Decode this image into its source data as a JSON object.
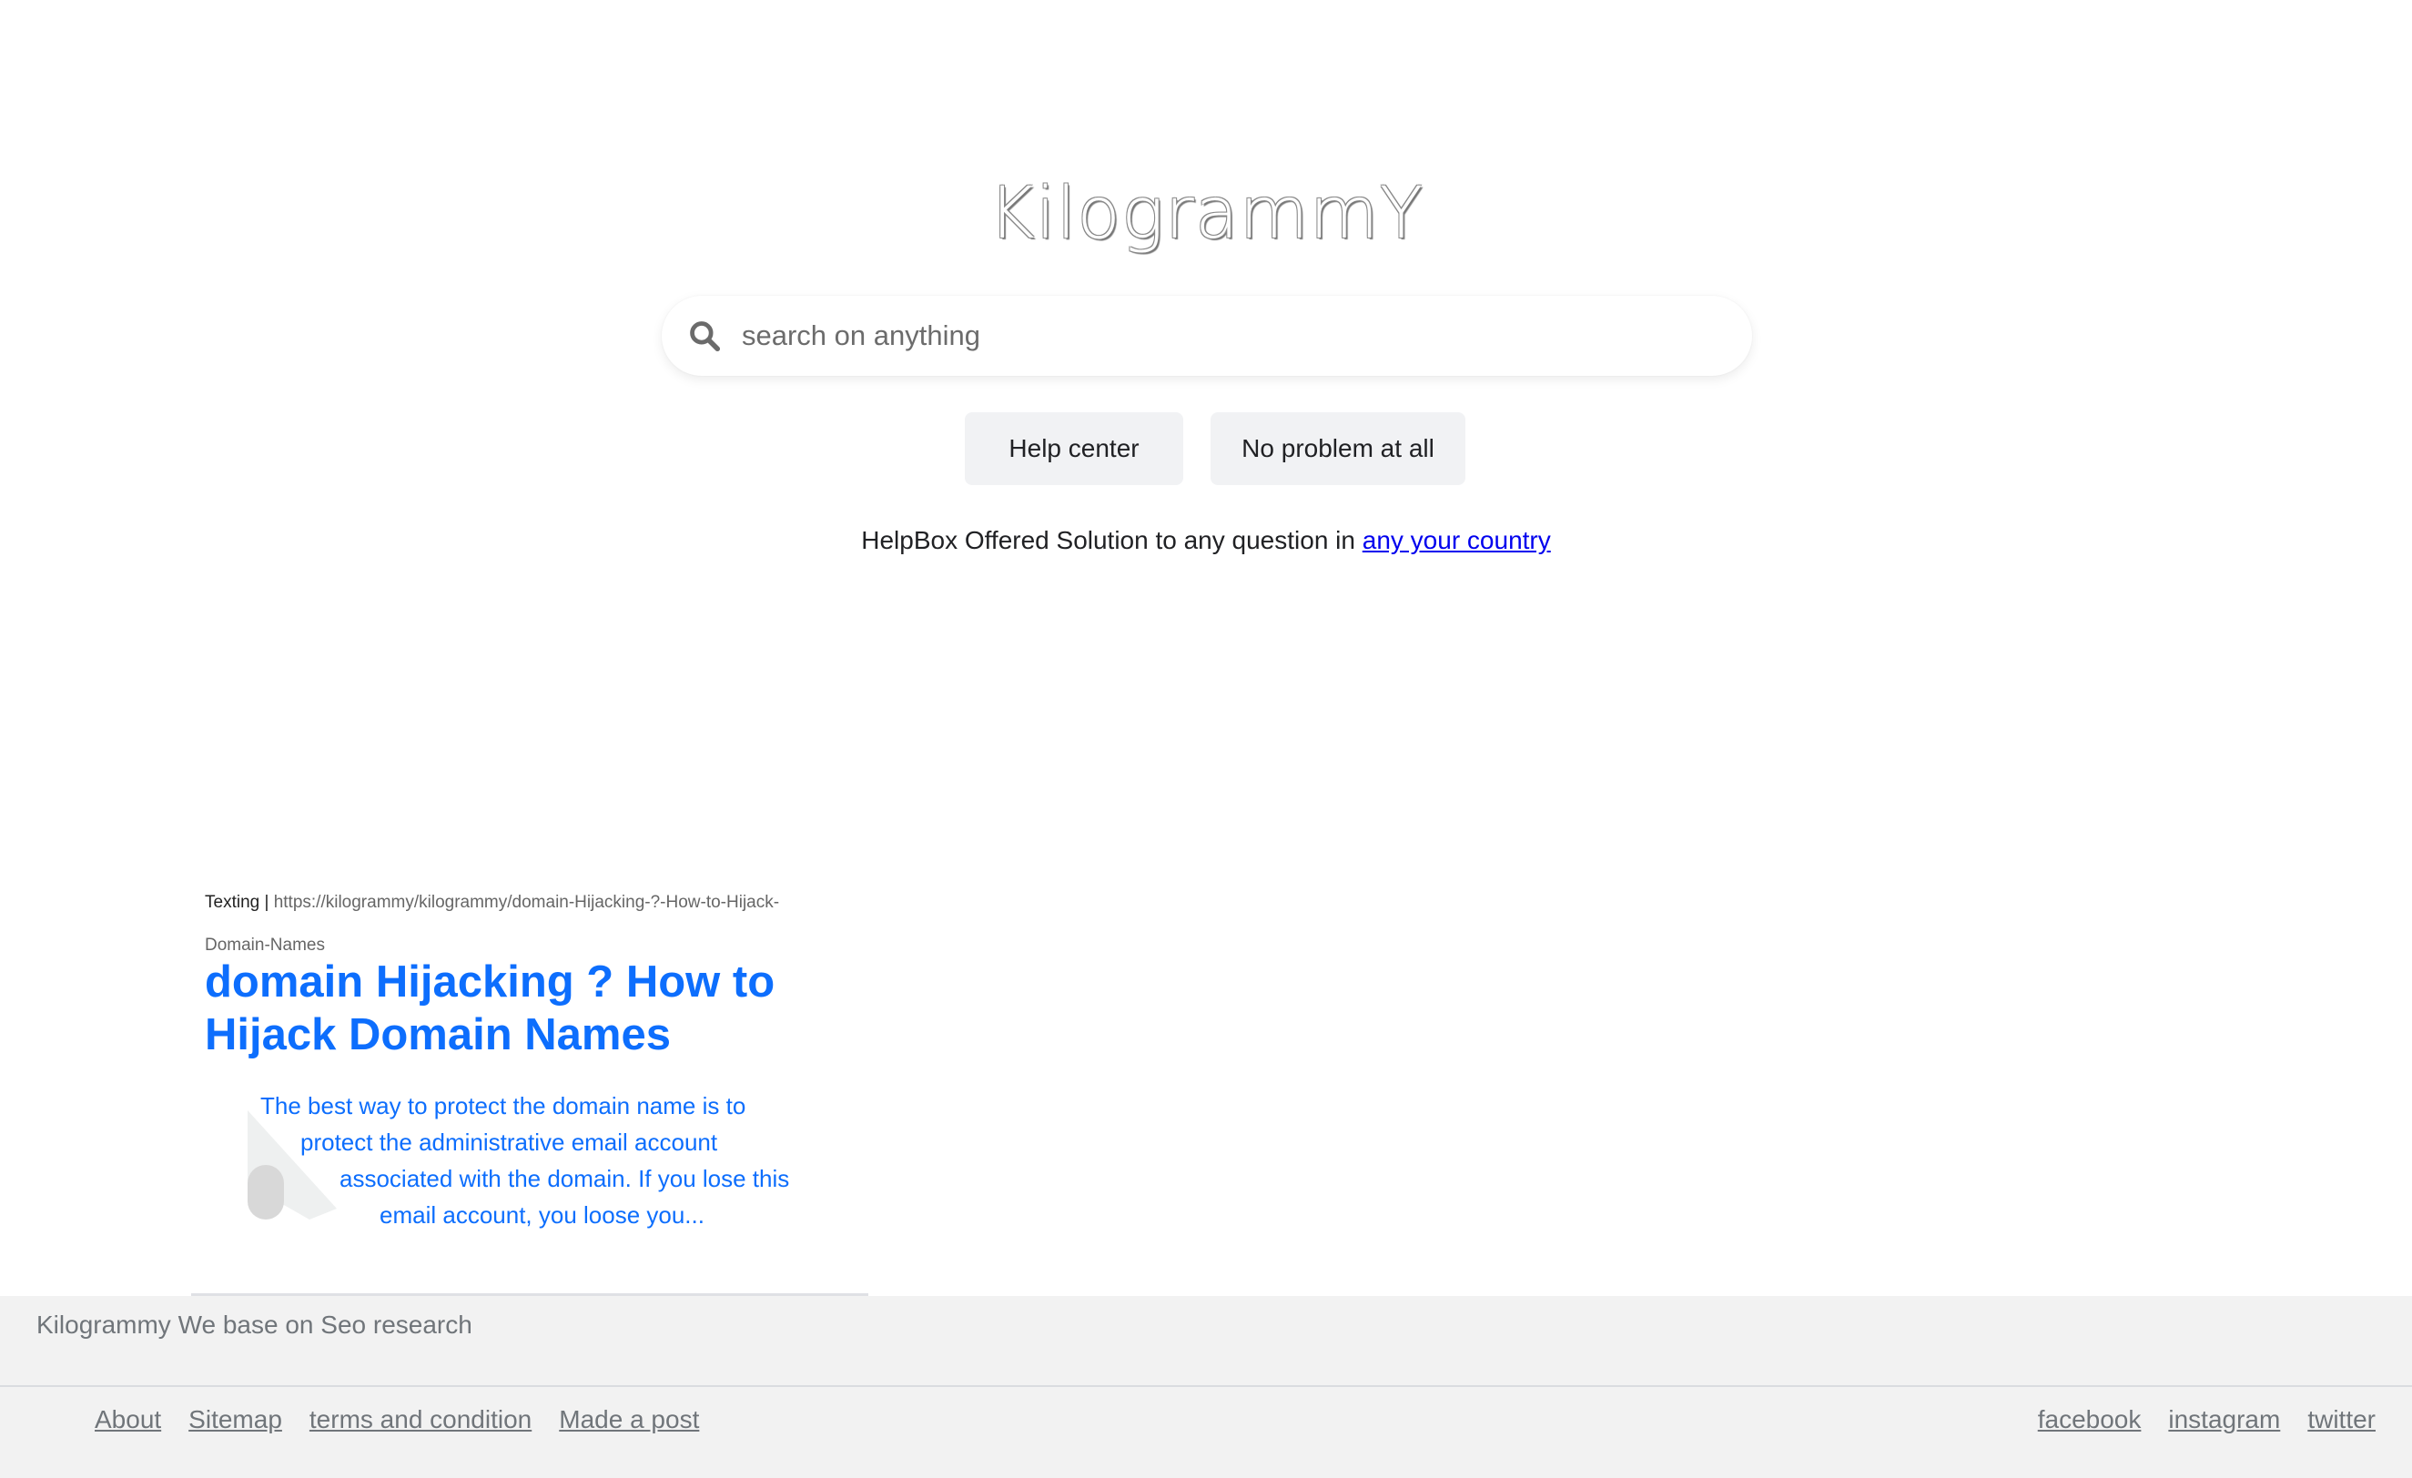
{
  "logo": "KilogrammY",
  "search": {
    "placeholder": "search on anything",
    "value": ""
  },
  "buttons": {
    "help_center": "Help center",
    "no_problem": "No problem at all"
  },
  "tagline": {
    "text": "HelpBox Offered Solution to any question in ",
    "link": "any your country"
  },
  "result": {
    "category": "Texting",
    "separator": "|",
    "url": "https://kilogrammy/kilogrammy/domain-Hijacking-?-How-to-Hijack-Domain-Names",
    "title": "domain Hijacking ? How to Hijack Domain Names",
    "snippet_lines": [
      "The best way to protect the domain name is to",
      "protect the administrative email account",
      "associated with the domain. If you lose this",
      "email account, you loose you..."
    ]
  },
  "footer": {
    "tagline": "Kilogrammy We base on Seo research",
    "left_links": [
      "About",
      "Sitemap",
      "terms and condition",
      "Made a post"
    ],
    "right_links": [
      "facebook",
      "instagram",
      "twitter"
    ]
  }
}
